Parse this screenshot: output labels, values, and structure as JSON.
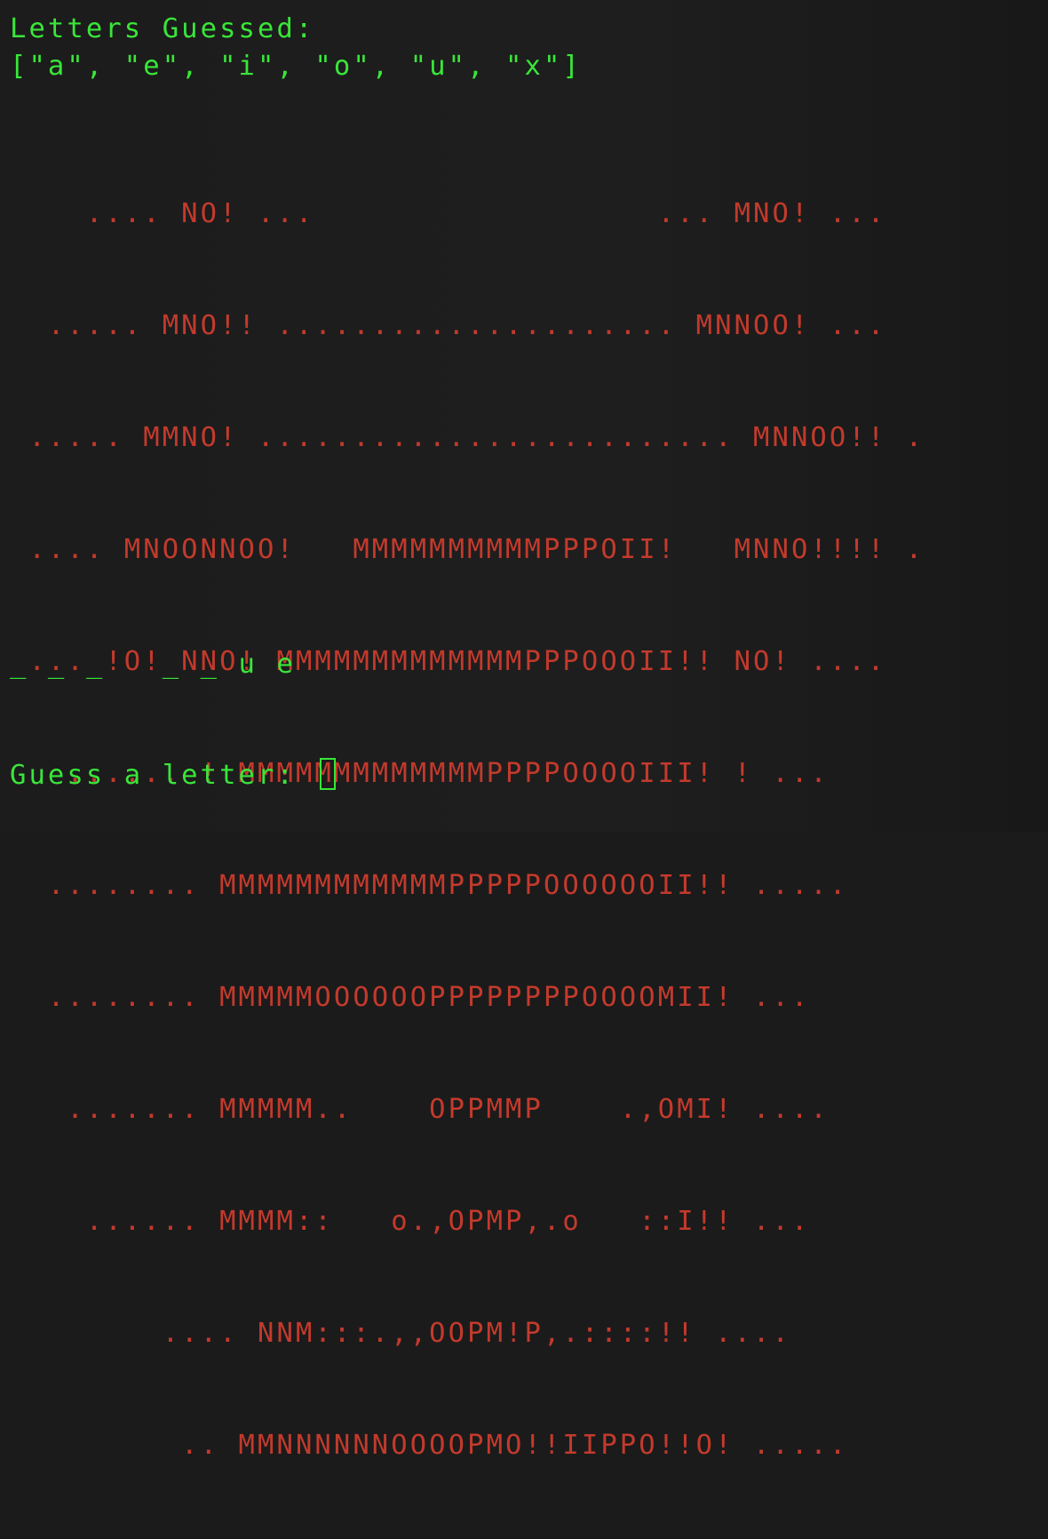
{
  "terminal": {
    "letters_label": "Letters Guessed:",
    "letters_list": "[\"a\", \"e\", \"i\", \"o\", \"u\", \"x\"]",
    "art_lines": [
      "    .... NO! ...                  ... MNO! ...",
      "  ..... MNO!! ..................... MNNOO! ...",
      " ..... MMNO! ......................... MNNOO!! .",
      " .... MNOONNOO!   MMMMMMMMMMPPPOII!   MNNO!!!! .",
      " ... !O! NNO! MMMMMMMMMMMMMPPPOOOII!! NO! ....",
      "   ...... ! MMMMMMMMMMMMMPPPPOOOOIII! ! ...",
      "  ........ MMMMMMMMMMMMPPPPPOOOOOOII!! .....",
      "  ........ MMMMMOOOOOOPPPPPPPPOOOOMII! ...",
      "   ....... MMMMM..    OPPMMP    .,OMI! ....",
      "    ...... MMMM::   o.,OPMP,.o   ::I!! ...",
      "        .... NNM:::.,,OOPM!P,.::::!! ....",
      "         .. MMNNNNNNOOOOPMO!!IIPPO!!O! ....."
    ],
    "word_progress": "_ _ _   _ _ u e",
    "prompt": "Guess a letter: "
  },
  "colors": {
    "prompt_text": "#39e639",
    "ascii_art": "#c33a2c",
    "background": "#1b1b1b"
  }
}
